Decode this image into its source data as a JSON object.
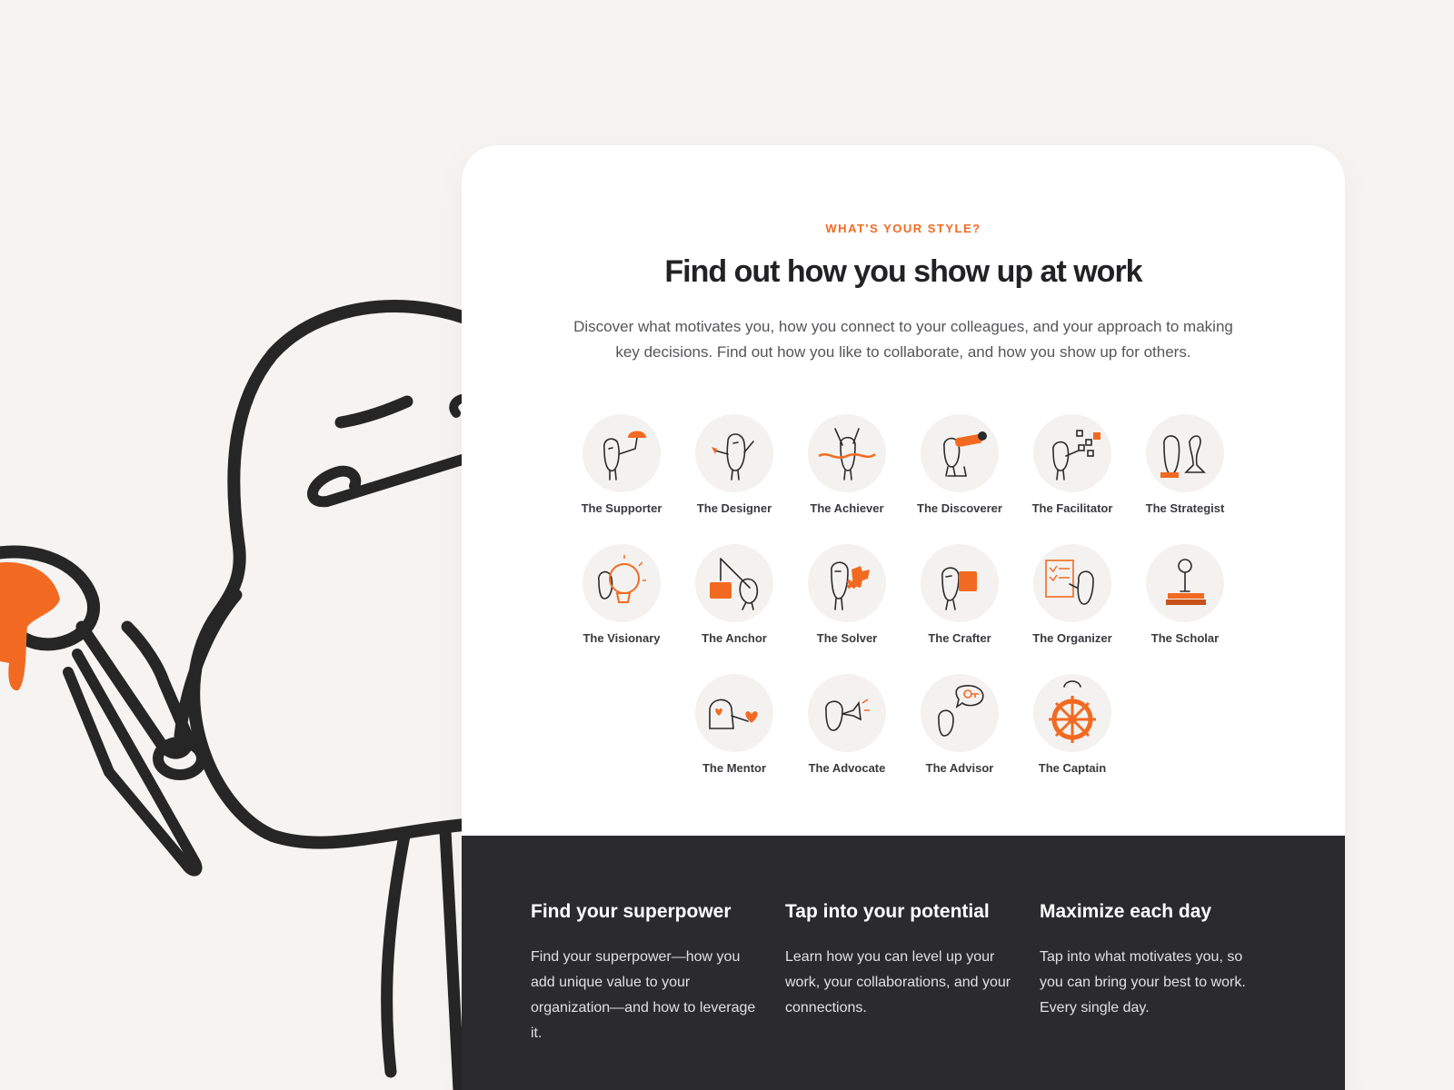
{
  "section": {
    "eyebrow": "WHAT'S YOUR STYLE?",
    "title": "Find out how you show up at work",
    "description": "Discover what motivates you, how you connect to your colleagues, and your approach to making key decisions. Find out how you like to collaborate, and how you show up for others."
  },
  "personalities": [
    {
      "label": "The Supporter",
      "icon": "umbrella-character-icon"
    },
    {
      "label": "The Designer",
      "icon": "paintbrush-character-icon"
    },
    {
      "label": "The Achiever",
      "icon": "finish-line-character-icon"
    },
    {
      "label": "The Discoverer",
      "icon": "telescope-character-icon"
    },
    {
      "label": "The Facilitator",
      "icon": "sticky-notes-character-icon"
    },
    {
      "label": "The Strategist",
      "icon": "chess-piece-character-icon"
    },
    {
      "label": "The Visionary",
      "icon": "lightbulb-character-icon"
    },
    {
      "label": "The Anchor",
      "icon": "anchor-rope-character-icon"
    },
    {
      "label": "The Solver",
      "icon": "puzzle-piece-character-icon"
    },
    {
      "label": "The Crafter",
      "icon": "cutting-board-character-icon"
    },
    {
      "label": "The Organizer",
      "icon": "checklist-character-icon"
    },
    {
      "label": "The Scholar",
      "icon": "books-character-icon"
    },
    {
      "label": "The Mentor",
      "icon": "hearts-character-icon"
    },
    {
      "label": "The Advocate",
      "icon": "megaphone-character-icon"
    },
    {
      "label": "The Advisor",
      "icon": "speech-bubble-key-character-icon"
    },
    {
      "label": "The Captain",
      "icon": "ship-wheel-character-icon"
    }
  ],
  "features": [
    {
      "title": "Find your superpower",
      "body": "Find your superpower—how you add unique value to your organization—and how to leverage it."
    },
    {
      "title": "Tap into your potential",
      "body": "Learn how you can level up your work, your collaborations, and your connections."
    },
    {
      "title": "Maximize each day",
      "body": "Tap into what motivates you, so you can bring your best to work. Every single day."
    }
  ],
  "colors": {
    "accent": "#f26a21",
    "ink": "#2b2b2d",
    "background": "#f5f4f2",
    "card": "#ffffff",
    "dark_panel": "#2b2b2d"
  }
}
